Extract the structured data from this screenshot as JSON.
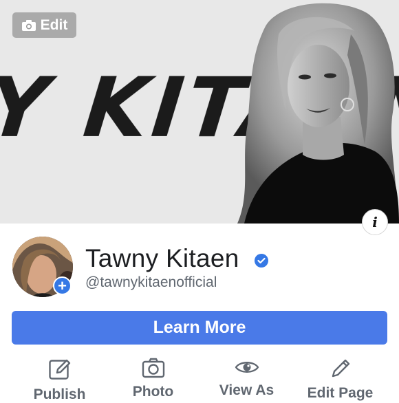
{
  "cover": {
    "edit_label": "Edit",
    "info_label": "i",
    "banner_text": "Y KITAEN"
  },
  "profile": {
    "name": "Tawny Kitaen",
    "handle": "@tawnykitaenofficial",
    "verified": true,
    "add_photo_symbol": "+"
  },
  "cta": {
    "label": "Learn More",
    "color": "#4a7ae8"
  },
  "actions": [
    {
      "label": "Publish",
      "icon": "edit-icon"
    },
    {
      "label": "Photo",
      "icon": "camera-icon"
    },
    {
      "label": "View As",
      "icon": "eye-icon"
    },
    {
      "label": "Edit Page",
      "icon": "pencil-icon"
    }
  ],
  "colors": {
    "accent": "#3578e5",
    "icon_gray": "#606770"
  }
}
